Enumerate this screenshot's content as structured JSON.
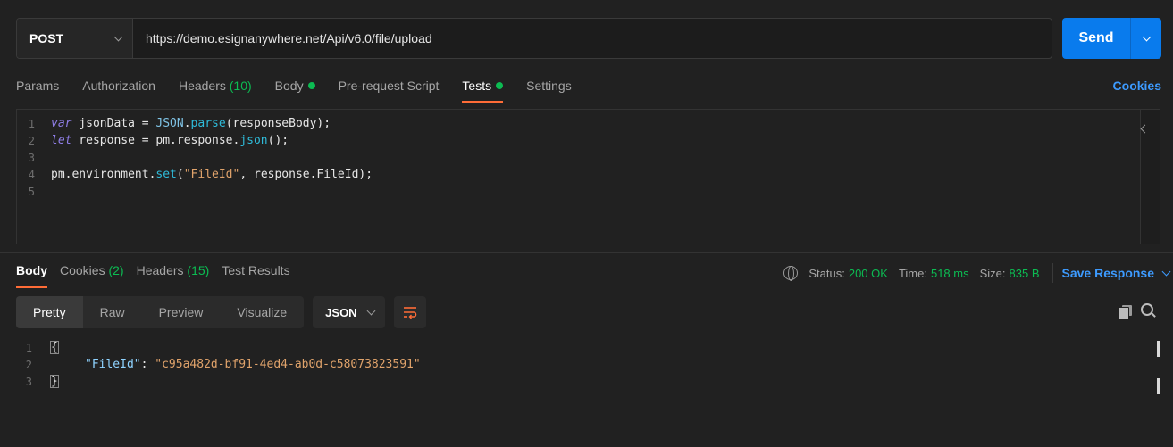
{
  "request": {
    "method": "POST",
    "url": "https://demo.esignanywhere.net/Api/v6.0/file/upload",
    "send_label": "Send"
  },
  "request_tabs": {
    "params": "Params",
    "authorization": "Authorization",
    "headers": "Headers",
    "headers_count": "(10)",
    "body": "Body",
    "prerequest": "Pre-request Script",
    "tests": "Tests",
    "settings": "Settings",
    "cookies": "Cookies"
  },
  "script": {
    "line_numbers": [
      "1",
      "2",
      "3",
      "4",
      "5"
    ],
    "line1": {
      "kw": "var",
      "ident": " jsonData = ",
      "obj": "JSON",
      "dot": ".",
      "fn": "parse",
      "rest": "(responseBody);"
    },
    "line2": {
      "kw": "let",
      "ident": " response = pm.response.",
      "fn": "json",
      "rest": "();"
    },
    "line4": {
      "head": "pm.environment.",
      "fn": "set",
      "open": "(",
      "str": "\"FileId\"",
      "rest": ", response.FileId);"
    }
  },
  "response_tabs": {
    "body": "Body",
    "cookies": "Cookies",
    "cookies_count": "(2)",
    "headers": "Headers",
    "headers_count": "(15)",
    "test_results": "Test Results"
  },
  "status": {
    "status_label": "Status:",
    "status_value": "200 OK",
    "time_label": "Time:",
    "time_value": "518 ms",
    "size_label": "Size:",
    "size_value": "835 B",
    "save_response": "Save Response"
  },
  "view_modes": {
    "pretty": "Pretty",
    "raw": "Raw",
    "preview": "Preview",
    "visualize": "Visualize",
    "format": "JSON"
  },
  "response_body": {
    "line_numbers": [
      "1",
      "2",
      "3"
    ],
    "open_brace": "{",
    "key": "\"FileId\"",
    "colon": ": ",
    "value": "\"c95a482d-bf91-4ed4-ab0d-c58073823591\"",
    "close_brace": "}"
  },
  "colors": {
    "send": "#097bed",
    "accent_tab": "#ff6c37",
    "status_green": "#0cbb52",
    "link_blue": "#3d9bff"
  }
}
